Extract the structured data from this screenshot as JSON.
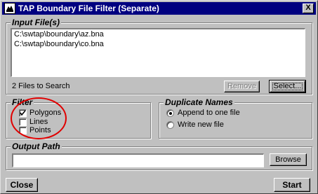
{
  "window": {
    "title": "TAP Boundary File Filter (Separate)",
    "close_glyph": "X"
  },
  "input_files": {
    "legend": "Input File(s)",
    "files": [
      "C:\\swtap\\boundary\\az.bna",
      "C:\\swtap\\boundary\\co.bna"
    ],
    "count_text": "2 Files to Search",
    "remove_label": "Remove",
    "select_label": "Select..."
  },
  "filter": {
    "legend": "Filter",
    "polygons": {
      "label": "Polygons",
      "checked": true
    },
    "lines": {
      "label": "Lines",
      "checked": false
    },
    "points": {
      "label": "Points",
      "checked": false
    }
  },
  "duplicate_names": {
    "legend": "Duplicate Names",
    "append_label": "Append to one file",
    "write_new_label": "Write new file",
    "selected": "append"
  },
  "output_path": {
    "legend": "Output Path",
    "value": "",
    "browse_label": "Browse"
  },
  "footer": {
    "close_label": "Close",
    "start_label": "Start"
  },
  "colors": {
    "titlebar": "#000080",
    "face": "#c0c0c0",
    "annotation": "#e00000"
  }
}
